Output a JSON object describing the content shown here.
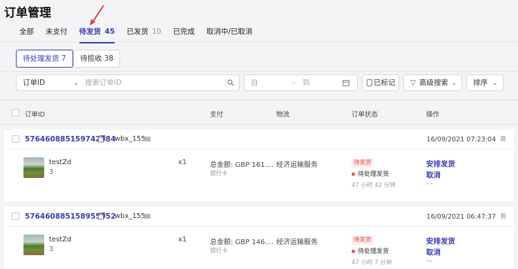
{
  "page": {
    "title": "订单管理"
  },
  "tabs": [
    {
      "label": "全部",
      "count": ""
    },
    {
      "label": "未支付",
      "count": ""
    },
    {
      "label": "待发货",
      "count": "45"
    },
    {
      "label": "已发货",
      "count": "10"
    },
    {
      "label": "已完成",
      "count": ""
    },
    {
      "label": "取消中/已取消",
      "count": ""
    }
  ],
  "subtabs": [
    {
      "label": "待处理发货 7"
    },
    {
      "label": "待揽收 38"
    }
  ],
  "filters": {
    "field_select": "订单ID",
    "search_placeholder": "搜索订单ID",
    "date_from": "自",
    "date_sep": "-",
    "date_to": "到",
    "marked_label": "已标记",
    "advanced_label": "高级搜索",
    "sort_label": "排序"
  },
  "table_header": {
    "order_id": "订单ID",
    "payment": "支付",
    "logistics": "物流",
    "status": "订单状态",
    "actions": "操作"
  },
  "orders": [
    {
      "id": "576460885159742384",
      "user": "wbx_155",
      "time": "16/09/2021 07:23:04",
      "product_name": "testZd",
      "product_qty": "3",
      "multiplier": "x1",
      "total": "总金额:   GBP 161....",
      "payment_method": "银行卡",
      "logistics": "经济运输服务",
      "badge": "待发货",
      "status": "待处理发货",
      "elapsed": "47 小时 42 分钟",
      "action_ship": "安排发货",
      "action_cancel": "取消",
      "more": "..."
    },
    {
      "id": "576460885158955952",
      "user": "wbx_155",
      "time": "16/09/2021 06:47:37",
      "product_name": "testZd",
      "product_qty": "3",
      "multiplier": "x1",
      "total": "总金额:   GBP 146....",
      "payment_method": "银行卡",
      "logistics": "经济运输服务",
      "badge": "待发货",
      "status": "待处理发货",
      "elapsed": "47 小时 7 分钟",
      "action_ship": "安排发货",
      "action_cancel": "取消",
      "more": "..."
    }
  ],
  "colors": {
    "accent": "#3b3bb5",
    "alert": "#e0534a",
    "arrow": "#e53935"
  }
}
